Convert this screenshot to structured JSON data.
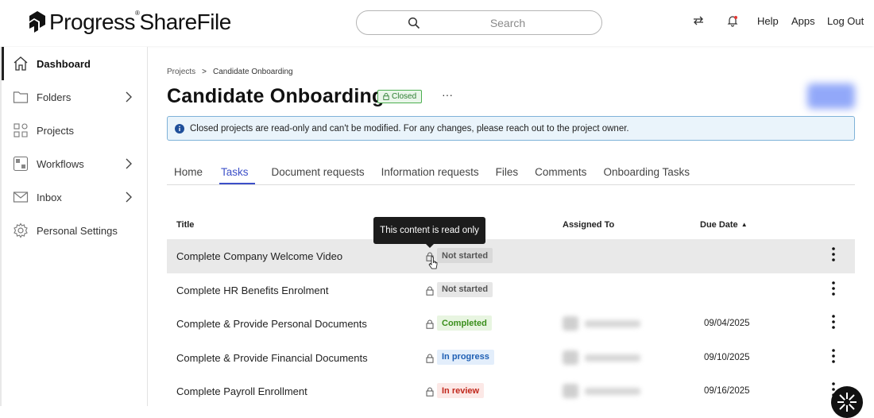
{
  "header": {
    "logo_text": "Progress",
    "logo_product": "ShareFile",
    "logo_tm": "®",
    "search_placeholder": "Search",
    "links": {
      "help": "Help",
      "apps": "Apps",
      "logout": "Log Out"
    }
  },
  "sidebar": {
    "items": [
      {
        "label": "Dashboard",
        "icon": "home-icon",
        "active": true
      },
      {
        "label": "Folders",
        "icon": "folder-icon",
        "has_chevron": true
      },
      {
        "label": "Projects",
        "icon": "projects-icon"
      },
      {
        "label": "Workflows",
        "icon": "workflow-icon",
        "has_chevron": true
      },
      {
        "label": "Inbox",
        "icon": "mail-icon",
        "has_chevron": true
      },
      {
        "label": "Personal Settings",
        "icon": "gear-icon"
      }
    ]
  },
  "breadcrumb": {
    "parent": "Projects",
    "separator": ">",
    "current": "Candidate Onboarding"
  },
  "page": {
    "title": "Candidate Onboarding",
    "status_badge": "Closed",
    "more_label": "···"
  },
  "banner": {
    "text": "Closed projects are read-only and can't be modified. For any changes, please reach out to the project owner."
  },
  "tabs": [
    {
      "label": "Home"
    },
    {
      "label": "Tasks",
      "active": true
    },
    {
      "label": "Document requests"
    },
    {
      "label": "Information requests"
    },
    {
      "label": "Files"
    },
    {
      "label": "Comments"
    },
    {
      "label": "Onboarding Tasks"
    }
  ],
  "table": {
    "headers": {
      "title": "Title",
      "assigned_to": "Assigned To",
      "due_date": "Due Date",
      "sort_indicator": "▲"
    },
    "rows": [
      {
        "title": "Complete Company Welcome Video",
        "status": "Not started",
        "status_kind": "not-started",
        "due": ""
      },
      {
        "title": "Complete HR Benefits Enrolment",
        "status": "Not started",
        "status_kind": "not-started",
        "due": ""
      },
      {
        "title": "Complete & Provide Personal Documents",
        "status": "Completed",
        "status_kind": "completed",
        "due": "09/04/2025"
      },
      {
        "title": "Complete & Provide Financial Documents",
        "status": "In progress",
        "status_kind": "in-progress",
        "due": "09/10/2025"
      },
      {
        "title": "Complete Payroll Enrollment",
        "status": "In review",
        "status_kind": "in-review",
        "due": "09/16/2025"
      }
    ]
  },
  "tooltip": {
    "text": "This content is read only"
  },
  "colors": {
    "accent": "#3d50c8",
    "closed_badge": "#2e7d32",
    "banner_border": "#7fb2d8",
    "completed": "#3a8f1b",
    "in_progress": "#1f5fb4",
    "in_review": "#c0271b"
  }
}
